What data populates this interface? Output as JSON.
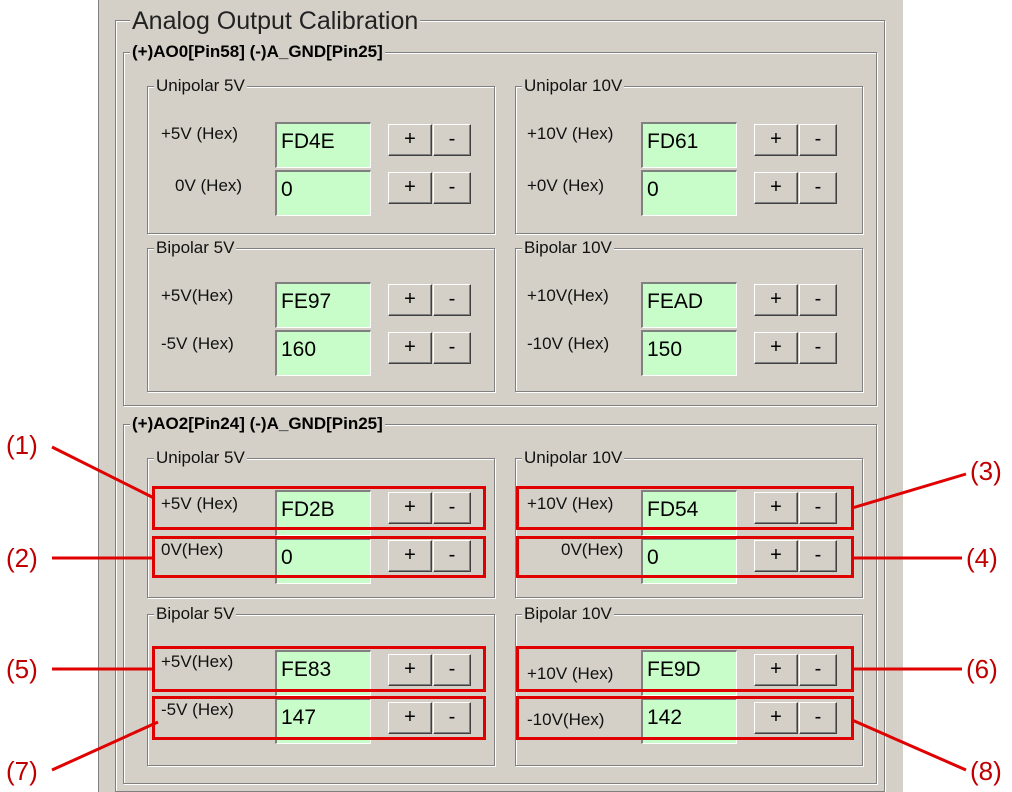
{
  "title": "Analog Output Calibration",
  "sections": [
    {
      "header": "(+)AO0[Pin58]   (-)A_GND[Pin25]",
      "groups": [
        {
          "name": "Unipolar 5V",
          "rows": [
            {
              "label": "+5V (Hex)",
              "value": "FD4E"
            },
            {
              "label": "0V (Hex)",
              "value": "0"
            }
          ]
        },
        {
          "name": "Unipolar 10V",
          "rows": [
            {
              "label": "+10V (Hex)",
              "value": "FD61"
            },
            {
              "label": "+0V (Hex)",
              "value": "0"
            }
          ]
        },
        {
          "name": "Bipolar 5V",
          "rows": [
            {
              "label": "+5V(Hex)",
              "value": "FE97"
            },
            {
              "label": "-5V (Hex)",
              "value": "160"
            }
          ]
        },
        {
          "name": "Bipolar 10V",
          "rows": [
            {
              "label": "+10V(Hex)",
              "value": "FEAD"
            },
            {
              "label": "-10V (Hex)",
              "value": "150"
            }
          ]
        }
      ]
    },
    {
      "header": "(+)AO2[Pin24]   (-)A_GND[Pin25]",
      "groups": [
        {
          "name": "Unipolar 5V",
          "rows": [
            {
              "label": "+5V (Hex)",
              "value": "FD2B"
            },
            {
              "label": "0V(Hex)",
              "value": "0"
            }
          ]
        },
        {
          "name": "Unipolar 10V",
          "rows": [
            {
              "label": "+10V (Hex)",
              "value": "FD54"
            },
            {
              "label": "0V(Hex)",
              "value": "0"
            }
          ]
        },
        {
          "name": "Bipolar 5V",
          "rows": [
            {
              "label": "+5V(Hex)",
              "value": "FE83"
            },
            {
              "label": "-5V (Hex)",
              "value": "147"
            }
          ]
        },
        {
          "name": "Bipolar 10V",
          "rows": [
            {
              "label": "+10V (Hex)",
              "value": "FE9D"
            },
            {
              "label": "-10V(Hex)",
              "value": "142"
            }
          ]
        }
      ]
    }
  ],
  "buttons": {
    "plus": "+",
    "minus": "-"
  },
  "callouts": [
    "(1)",
    "(2)",
    "(3)",
    "(4)",
    "(5)",
    "(6)",
    "(7)",
    "(8)"
  ],
  "colors": {
    "field_bg": "#c8fcc8",
    "highlight": "#e00000",
    "panel_bg": "#d4d0c8"
  }
}
